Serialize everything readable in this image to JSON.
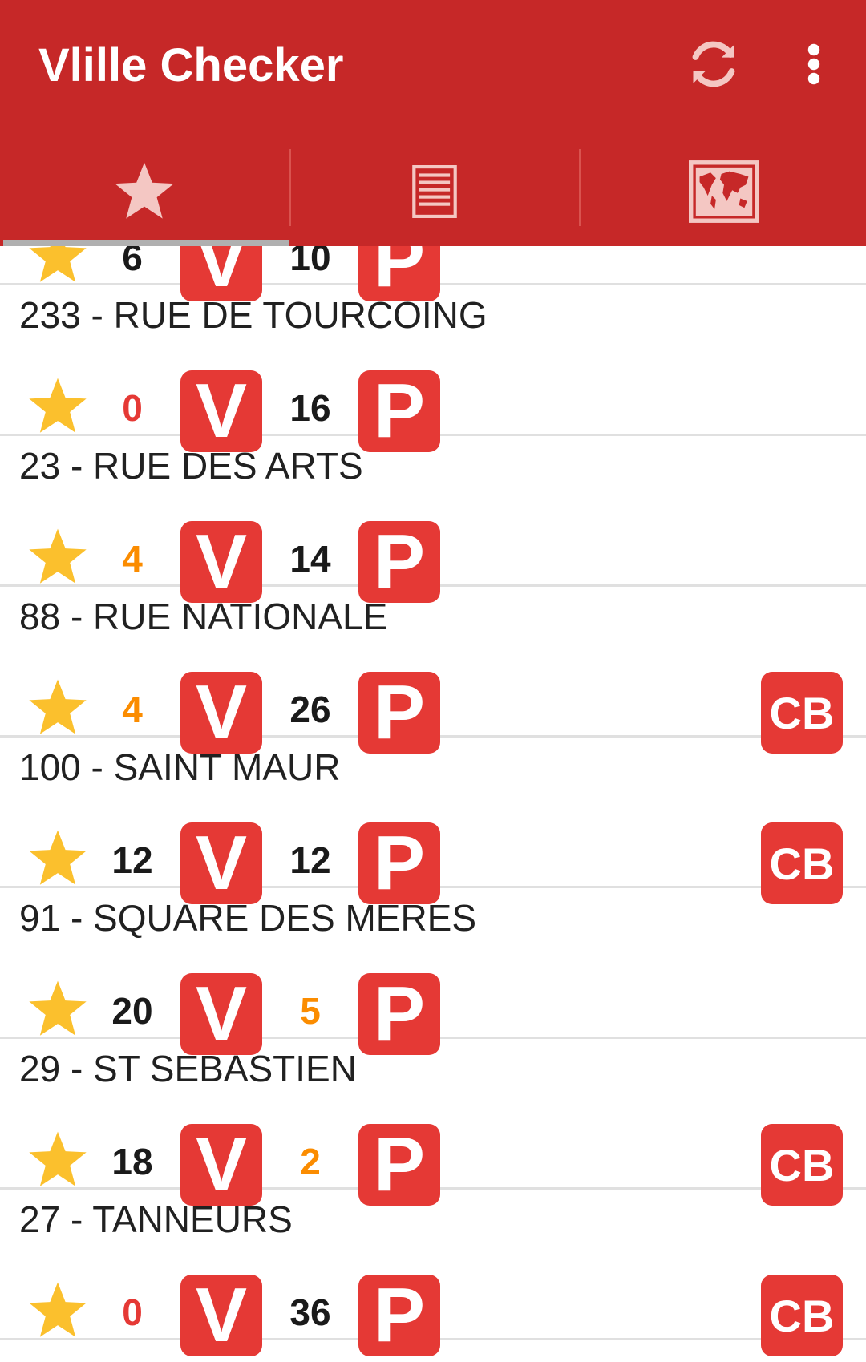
{
  "app": {
    "title": "Vlille Checker",
    "colors": {
      "primary": "#c62828",
      "badge": "#e53935",
      "star": "#fbc02d",
      "count_normal": "#1a1a1a",
      "count_empty": "#e53935",
      "count_low": "#fb8c00"
    }
  },
  "toolbar": {
    "refresh_icon": "refresh-icon",
    "more_icon": "more-vert-icon"
  },
  "tabs": [
    {
      "name": "favorites",
      "icon": "star-icon",
      "selected": true
    },
    {
      "name": "list",
      "icon": "list-icon",
      "selected": false
    },
    {
      "name": "map",
      "icon": "map-icon",
      "selected": false
    }
  ],
  "badges": {
    "bikes": "V",
    "places": "P",
    "card": "CB"
  },
  "stations": [
    {
      "name": "",
      "bikes": "6",
      "places": "10",
      "cb": false,
      "bikes_level": "normal",
      "places_level": "normal"
    },
    {
      "name": "233 - RUE DE TOURCOING",
      "bikes": "0",
      "places": "16",
      "cb": false,
      "bikes_level": "empty",
      "places_level": "normal"
    },
    {
      "name": "23 - RUE DES ARTS",
      "bikes": "4",
      "places": "14",
      "cb": false,
      "bikes_level": "low",
      "places_level": "normal"
    },
    {
      "name": "88 - RUE NATIONALE",
      "bikes": "4",
      "places": "26",
      "cb": true,
      "bikes_level": "low",
      "places_level": "normal"
    },
    {
      "name": "100 - SAINT MAUR",
      "bikes": "12",
      "places": "12",
      "cb": true,
      "bikes_level": "normal",
      "places_level": "normal"
    },
    {
      "name": "91 - SQUARE DES MERES",
      "bikes": "20",
      "places": "5",
      "cb": false,
      "bikes_level": "normal",
      "places_level": "low"
    },
    {
      "name": "29 - ST SEBASTIEN",
      "bikes": "18",
      "places": "2",
      "cb": true,
      "bikes_level": "normal",
      "places_level": "low"
    },
    {
      "name": "27 - TANNEURS",
      "bikes": "0",
      "places": "36",
      "cb": true,
      "bikes_level": "empty",
      "places_level": "normal"
    }
  ]
}
